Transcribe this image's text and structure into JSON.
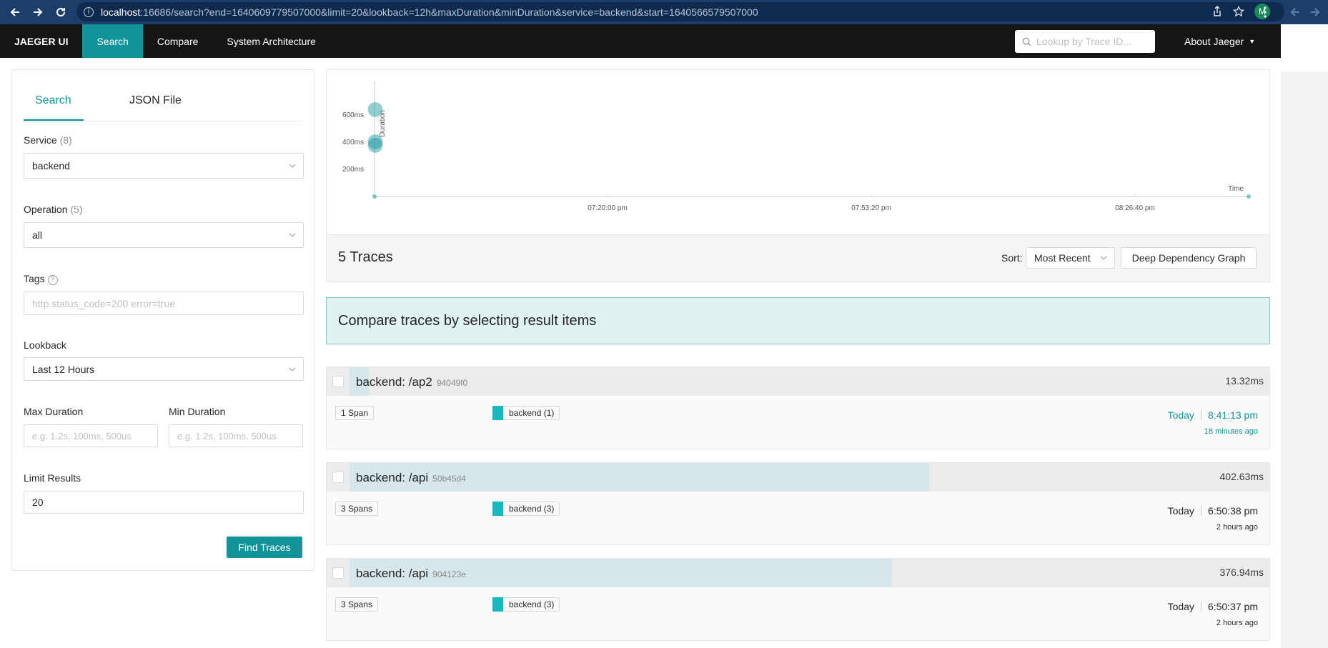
{
  "browser": {
    "url_host": "localhost",
    "url_rest": ":16686/search?end=1640609779507000&limit=20&lookback=12h&maxDuration&minDuration&service=backend&start=1640566579507000",
    "profile_initial": "M"
  },
  "nav": {
    "brand": "JAEGER UI",
    "items": [
      "Search",
      "Compare",
      "System Architecture"
    ],
    "lookup_placeholder": "Lookup by Trace ID...",
    "about": "About Jaeger"
  },
  "search_form": {
    "tabs": [
      "Search",
      "JSON File"
    ],
    "service_label": "Service",
    "service_count": "(8)",
    "service_value": "backend",
    "operation_label": "Operation",
    "operation_count": "(5)",
    "operation_value": "all",
    "tags_label": "Tags",
    "tags_placeholder": "http.status_code=200 error=true",
    "lookback_label": "Lookback",
    "lookback_value": "Last 12 Hours",
    "max_duration_label": "Max Duration",
    "max_duration_placeholder": "e.g. 1.2s, 100ms, 500us",
    "min_duration_label": "Min Duration",
    "min_duration_placeholder": "e.g. 1.2s, 100ms, 500us",
    "limit_label": "Limit Results",
    "limit_value": "20",
    "find_button": "Find Traces"
  },
  "chart_data": {
    "type": "scatter",
    "ylabel": "Duration",
    "xlabel": "Time",
    "y_ticks": [
      "200ms",
      "400ms",
      "600ms"
    ],
    "x_ticks": [
      "07:20:00 pm",
      "07:53:20 pm",
      "08:26:40 pm"
    ],
    "ylim_ms": [
      0,
      700
    ],
    "points": [
      {
        "duration_ms": 640
      },
      {
        "duration_ms": 402.63
      },
      {
        "duration_ms": 376.94
      }
    ]
  },
  "results": {
    "count_label": "5 Traces",
    "sort_label": "Sort:",
    "sort_value": "Most Recent",
    "ddg_button": "Deep Dependency Graph",
    "compare_banner": "Compare traces by selecting result items"
  },
  "traces": [
    {
      "name": "backend: /ap2",
      "id": "94049f0",
      "duration": "13.32ms",
      "duration_fraction": 0.02,
      "spans": "1 Span",
      "service": "backend (1)",
      "day": "Today",
      "time": "8:41:13 pm",
      "ago": "18 minutes ago"
    },
    {
      "name": "backend: /api",
      "id": "50b45d4",
      "duration": "402.63ms",
      "duration_fraction": 0.63,
      "spans": "3 Spans",
      "service": "backend (3)",
      "day": "Today",
      "time": "6:50:38 pm",
      "ago": "2 hours ago"
    },
    {
      "name": "backend: /api",
      "id": "904123e",
      "duration": "376.94ms",
      "duration_fraction": 0.59,
      "spans": "3 Spans",
      "service": "backend (3)",
      "day": "Today",
      "time": "6:50:37 pm",
      "ago": "2 hours ago"
    }
  ]
}
